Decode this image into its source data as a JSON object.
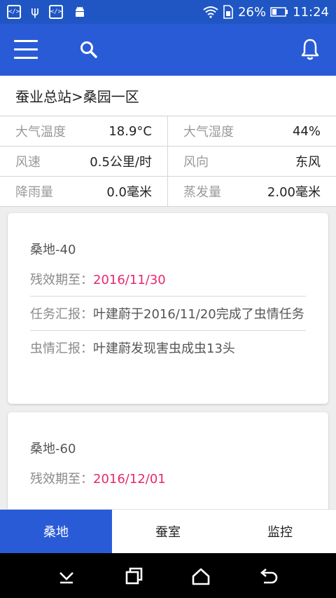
{
  "status_bar": {
    "battery": "26%",
    "time": "11:24",
    "left_icons": [
      "code-icon",
      "usb-icon",
      "code-icon",
      "android-icon"
    ]
  },
  "app_bar": {
    "icons": [
      "menu-icon",
      "search-icon",
      "bell-icon"
    ],
    "accent_color": "#2a5bd7"
  },
  "breadcrumb": "蚕业总站>桑园一区",
  "weather": [
    [
      {
        "label": "大气温度",
        "value": "18.9°C"
      },
      {
        "label": "大气湿度",
        "value": "44%"
      }
    ],
    [
      {
        "label": "风速",
        "value": "0.5公里/时"
      },
      {
        "label": "风向",
        "value": "东风"
      }
    ],
    [
      {
        "label": "降雨量",
        "value": "0.0毫米"
      },
      {
        "label": "蒸发量",
        "value": "2.00毫米"
      }
    ]
  ],
  "cards": [
    {
      "title": "桑地-40",
      "residue_label": "残效期至：",
      "residue_date": "2016/11/30",
      "task_label": "任务汇报：",
      "task_value": "叶建蔚于2016/11/20完成了虫情任务",
      "pest_label": "虫情汇报：",
      "pest_value": "叶建蔚发现害虫成虫13头"
    },
    {
      "title": "桑地-60",
      "residue_label": "残效期至：",
      "residue_date": "2016/12/01"
    }
  ],
  "tabs": [
    {
      "label": "桑地",
      "active": true
    },
    {
      "label": "蚕室",
      "active": false
    },
    {
      "label": "监控",
      "active": false
    }
  ],
  "nav_bar": {
    "icons": [
      "hide-keyboard-icon",
      "recents-icon",
      "home-icon",
      "back-icon"
    ]
  }
}
